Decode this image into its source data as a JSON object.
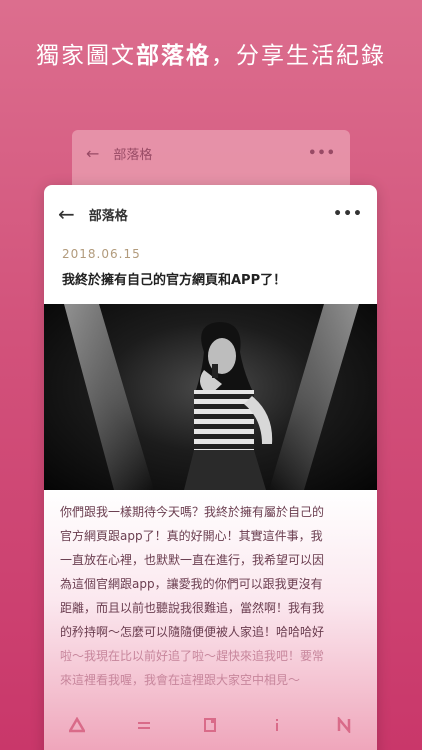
{
  "headline": {
    "part1": "獨家圖文",
    "bold": "部落格",
    "part2": "，分享生活紀錄"
  },
  "back_card": {
    "title": "部落格",
    "more": "•••"
  },
  "card": {
    "title": "部落格",
    "more": "•••"
  },
  "post": {
    "date": "2018.06.15",
    "title": "我終於擁有自己的官方網頁和APP了！",
    "lines": [
      "你們跟我一樣期待今天嗎？我終於擁有屬於自己的",
      "官方網頁跟app了！真的好開心！其實這件事，我",
      "一直放在心裡，也默默一直在進行，我希望可以因",
      "為這個官網跟app，讓愛我的你們可以跟我更沒有",
      "距離，而且以前也聽說我很難追，當然啊！我有我",
      "的矜持啊～怎麼可以隨隨便便被人家追！哈哈哈好",
      "啦～我現在比以前好追了啦～趕快來追我吧！要常",
      "來這裡看我喔，我會在這裡跟大家空中相見～"
    ]
  },
  "colors": {
    "accent": "#d2527b",
    "date": "#b29b7c"
  },
  "tabs": [
    {
      "icon": "triangle-icon",
      "label": ""
    },
    {
      "icon": "swap-icon",
      "label": ""
    },
    {
      "icon": "page-icon",
      "label": ""
    },
    {
      "icon": "info-icon",
      "label": ""
    },
    {
      "icon": "n-icon",
      "label": ""
    }
  ]
}
